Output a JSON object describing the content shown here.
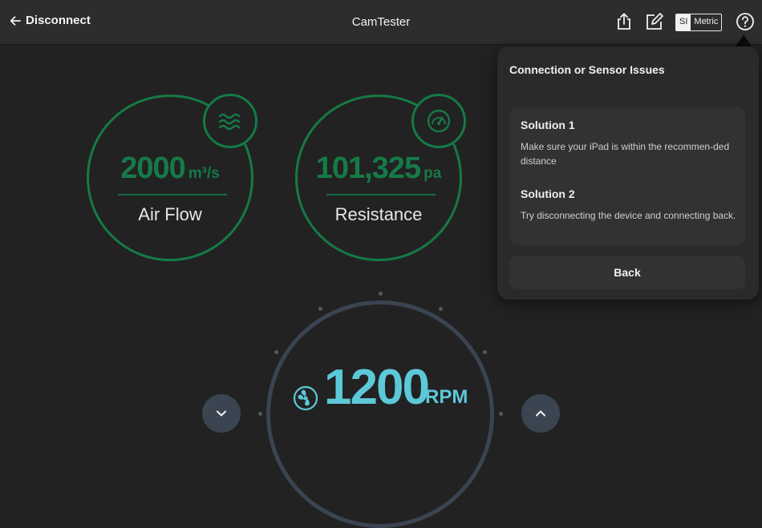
{
  "header": {
    "back_label": "Disconnect",
    "title": "CamTester",
    "unit_si": "SI",
    "unit_metric": "Metric",
    "unit_selected": "SI"
  },
  "gauges": [
    {
      "value": "2000",
      "unit": "m³/s",
      "label": "Air Flow",
      "icon": "airflow-waves-icon"
    },
    {
      "value": "101,325",
      "unit": "pa",
      "label": "Resistance",
      "icon": "pressure-gauge-icon"
    }
  ],
  "rpm": {
    "value": "1200",
    "unit": "RPM",
    "icon": "fan-icon"
  },
  "popover": {
    "title": "Connection or Sensor Issues",
    "solutions": [
      {
        "title": "Solution 1",
        "text": "Make sure your iPad is within the recommen-ded distance"
      },
      {
        "title": "Solution 2",
        "text": "Try disconnecting the device and connecting back."
      }
    ],
    "back_label": "Back"
  },
  "colors": {
    "gauge_green": "#157a45",
    "rpm_cyan": "#5cc8d8",
    "background": "#222223"
  }
}
